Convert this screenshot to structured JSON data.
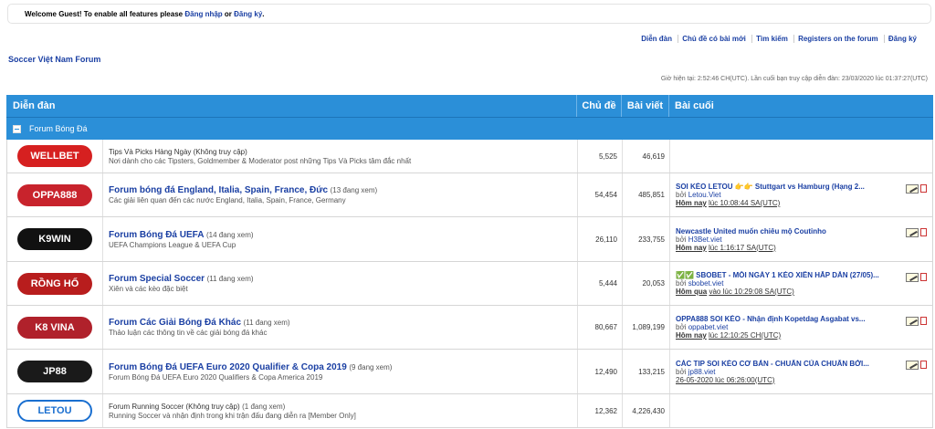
{
  "welcome": {
    "prefix": "Welcome Guest! To enable all features please",
    "login": "Đăng nhập",
    "or": "or",
    "register": "Đăng ký",
    "suffix": "."
  },
  "topnav": [
    "Diễn đàn",
    "Chủ đề có bài mới",
    "Tìm kiếm",
    "Registers on the forum",
    "Đăng ký"
  ],
  "forum_title": "Soccer Việt Nam Forum",
  "time_info": "Giờ hiện tại: 2:52:46 CH(UTC). Lần cuối bạn truy cập diễn đàn: 23/03/2020 lúc 01:37:27(UTC)",
  "header": {
    "forum": "Diễn đàn",
    "topics": "Chủ đề",
    "posts": "Bài viết",
    "last": "Bài cuối"
  },
  "category": "Forum Bóng Đá",
  "rows": [
    {
      "logo": "WELLBET",
      "logo_color": "#d62020",
      "name": "Tips Và Picks Hàng Ngày (Không truy cập)",
      "viewing": "",
      "desc": "Nơi dành cho các Tipsters, Goldmember & Moderator post những Tips Và Picks tâm đắc nhất",
      "topics": "5,525",
      "posts": "46,619",
      "last_title": "",
      "last_by": "",
      "last_when_day": "",
      "last_when_time": ""
    },
    {
      "logo": "OPPA888",
      "logo_color": "#c8232c",
      "name": "Forum bóng đá England, Italia, Spain, France, Đức",
      "viewing": "(13 đang xem)",
      "desc": "Các giải liên quan đến các nước England, Italia, Spain, France, Germany",
      "topics": "54,454",
      "posts": "485,851",
      "last_title": "SOI KÈO LETOU 👉👉 Stuttgart vs Hamburg (Hạng 2...",
      "last_by": "Letou.Viet",
      "last_when_day": "Hôm nay",
      "last_when_time": "lúc 10:08:44 SA(UTC)"
    },
    {
      "logo": "K9WIN",
      "logo_color": "#111111",
      "name": "Forum Bóng Đá UEFA",
      "viewing": "(14 đang xem)",
      "desc": "UEFA Champions League & UEFA Cup",
      "topics": "26,110",
      "posts": "233,755",
      "last_title": "Newcastle United muốn chiêu mộ Coutinho",
      "last_by": "H3Bet.viet",
      "last_when_day": "Hôm nay",
      "last_when_time": "lúc 1:16:17 SA(UTC)"
    },
    {
      "logo": "RỒNG HỔ",
      "logo_color": "#b81d1d",
      "name": "Forum Special Soccer",
      "viewing": "(11 đang xem)",
      "desc": "Xiên và các kèo đặc biệt",
      "topics": "5,444",
      "posts": "20,053",
      "last_title": "✅✅ SBOBET - MỖI NGÀY 1 KÈO XIÊN HẤP DẪN (27/05)...",
      "last_by": "sbobet.viet",
      "last_when_day": "Hôm qua",
      "last_when_time": "vào lúc 10:29:08 SA(UTC)"
    },
    {
      "logo": "K8 VINA",
      "logo_color": "#b0212b",
      "name": "Forum Các Giải Bóng Đá Khác",
      "viewing": "(11 đang xem)",
      "desc": "Thảo luận các thông tin về các giải bóng đá khác",
      "topics": "80,667",
      "posts": "1,089,199",
      "last_title": "OPPA888 SOI KÈO - Nhận định Kopetdag Asgabat vs...",
      "last_by": "oppabet.viet",
      "last_when_day": "Hôm nay",
      "last_when_time": "lúc 12:10:25 CH(UTC)"
    },
    {
      "logo": "JP88",
      "logo_color": "#1a1a1a",
      "name": "Forum Bóng Đá UEFA Euro 2020 Qualifier & Copa 2019",
      "viewing": "(9 đang xem)",
      "desc": "Forum Bóng Đá UEFA Euro 2020 Qualifiers & Copa America 2019",
      "topics": "12,490",
      "posts": "133,215",
      "last_title": "CÁC TIP SOI KÈO CƠ BẢN - CHUẨN CỦA CHUẨN BỞI...",
      "last_by": "jp88.viet",
      "last_when_day": "",
      "last_when_time": "26-05-2020 lúc 06:26:00(UTC)"
    },
    {
      "logo": "LETOU",
      "logo_color": "#ffffff",
      "name": "Forum Running Soccer (Không truy cập)",
      "viewing": "(1 đang xem)",
      "desc": "Running Soccer và nhận định trong khi trận đấu đang diễn ra [Member Only]",
      "topics": "12,362",
      "posts": "4,226,430",
      "last_title": "",
      "last_by": "",
      "last_when_day": "",
      "last_when_time": ""
    }
  ],
  "by_label": "bởi"
}
